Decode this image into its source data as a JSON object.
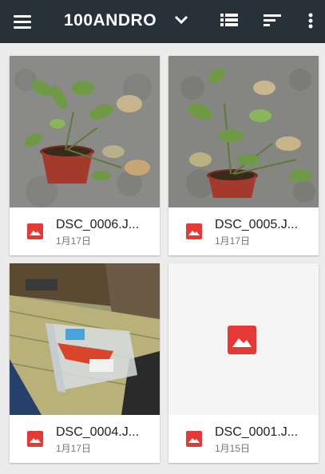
{
  "appbar": {
    "title": "100ANDRO",
    "icons": [
      "menu-icon",
      "chevron-down-icon",
      "list-view-icon",
      "sort-icon",
      "more-vert-icon"
    ]
  },
  "colors": {
    "appbar_bg": "#263238",
    "image_icon_red": "#e53935",
    "card_bg": "#ffffff",
    "background": "#ececec"
  },
  "files": [
    {
      "name": "DSC_0006.J...",
      "date": "1月17日",
      "thumbnail": "photo-potted-plant"
    },
    {
      "name": "DSC_0005.J...",
      "date": "1月17日",
      "thumbnail": "photo-potted-plant"
    },
    {
      "name": "DSC_0004.J...",
      "date": "1月17日",
      "thumbnail": "photo-storage-box"
    },
    {
      "name": "DSC_0001.J...",
      "date": "1月15日",
      "thumbnail": "image-placeholder-icon"
    }
  ]
}
